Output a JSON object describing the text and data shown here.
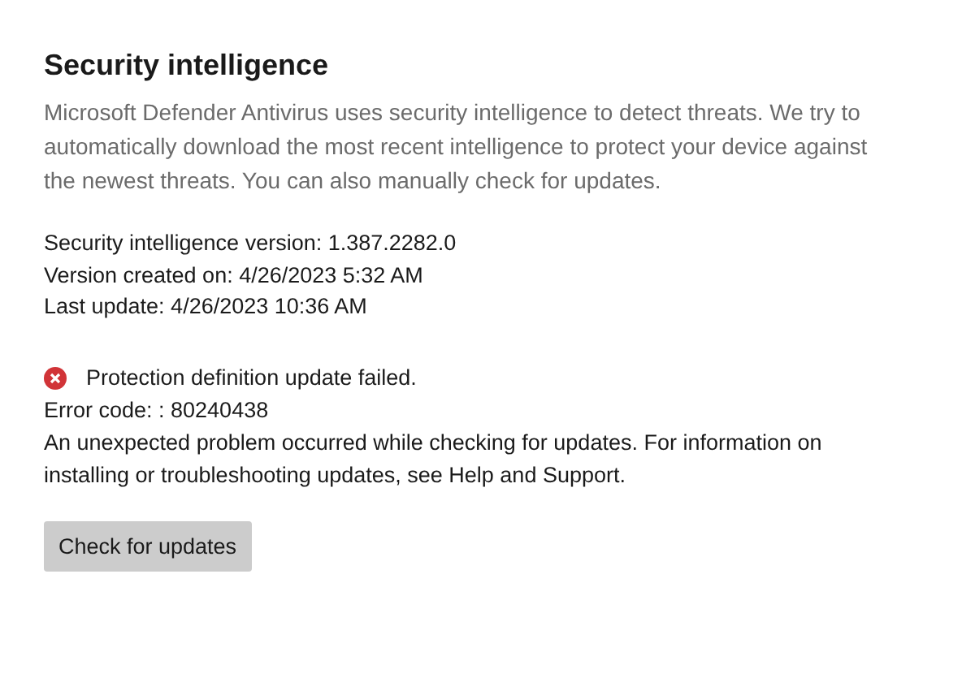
{
  "title": "Security intelligence",
  "description": "Microsoft Defender Antivirus uses security intelligence to detect threats. We try to automatically download the most recent intelligence to protect your device against the newest threats. You can also manually check for updates.",
  "info": [
    "Security intelligence version: 1.387.2282.0",
    "Version created on: 4/26/2023 5:32 AM",
    "Last update: 4/26/2023 10:36 AM"
  ],
  "status": {
    "kind": "error",
    "message": "Protection definition update failed.",
    "error_code": "Error code: : 80240438",
    "details": "An unexpected problem occurred while checking for updates. For information on installing or troubleshooting updates, see Help and Support."
  },
  "button": "Check for updates"
}
